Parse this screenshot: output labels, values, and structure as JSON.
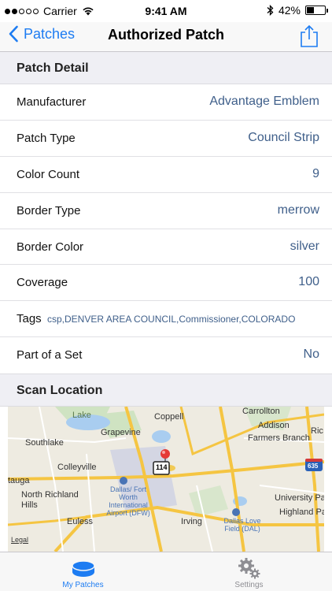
{
  "status_bar": {
    "carrier": "Carrier",
    "time": "9:41 AM",
    "battery": "42%",
    "battery_level": 0.42
  },
  "nav": {
    "back_label": "Patches",
    "title": "Authorized Patch"
  },
  "sections": {
    "detail": "Patch Detail",
    "location": "Scan Location"
  },
  "rows": [
    {
      "label": "Manufacturer",
      "value": "Advantage Emblem"
    },
    {
      "label": "Patch Type",
      "value": "Council Strip"
    },
    {
      "label": "Color Count",
      "value": "9"
    },
    {
      "label": "Border Type",
      "value": "merrow"
    },
    {
      "label": "Border Color",
      "value": "silver"
    },
    {
      "label": "Coverage",
      "value": "100"
    },
    {
      "label": "Tags",
      "value": "csp,DENVER AREA COUNCIL,Commissioner,COLORADO"
    },
    {
      "label": "Part of a Set",
      "value": "No"
    }
  ],
  "map": {
    "labels": {
      "lake": "Lake",
      "carrollton": "Carrollton",
      "coppell": "Coppell",
      "addison": "Addison",
      "southlake": "Southlake",
      "grapevine": "Grapevine",
      "farmers_branch": "Farmers Branch",
      "ric": "Ric",
      "colleyville": "Colleyville",
      "dfw_airport": "Dallas/ Fort Worth International Airport (DFW)",
      "tauga": "tauga",
      "north_richland_hills": "North Richland Hills",
      "euless": "Euless",
      "irving": "Irving",
      "university_park": "University Pa",
      "highland_park": "Highland Pa",
      "love_field": "Dallas Love Field (DAL)",
      "legal": "Legal",
      "highway_635": "635",
      "highway_114": "114"
    },
    "pin_color": "#e53935"
  },
  "tabs": [
    {
      "label": "My Patches",
      "active": true
    },
    {
      "label": "Settings",
      "active": false
    }
  ],
  "colors": {
    "accent": "#1d7cf2",
    "value_text": "#3f5f8a",
    "section_bg": "#efeff4"
  }
}
